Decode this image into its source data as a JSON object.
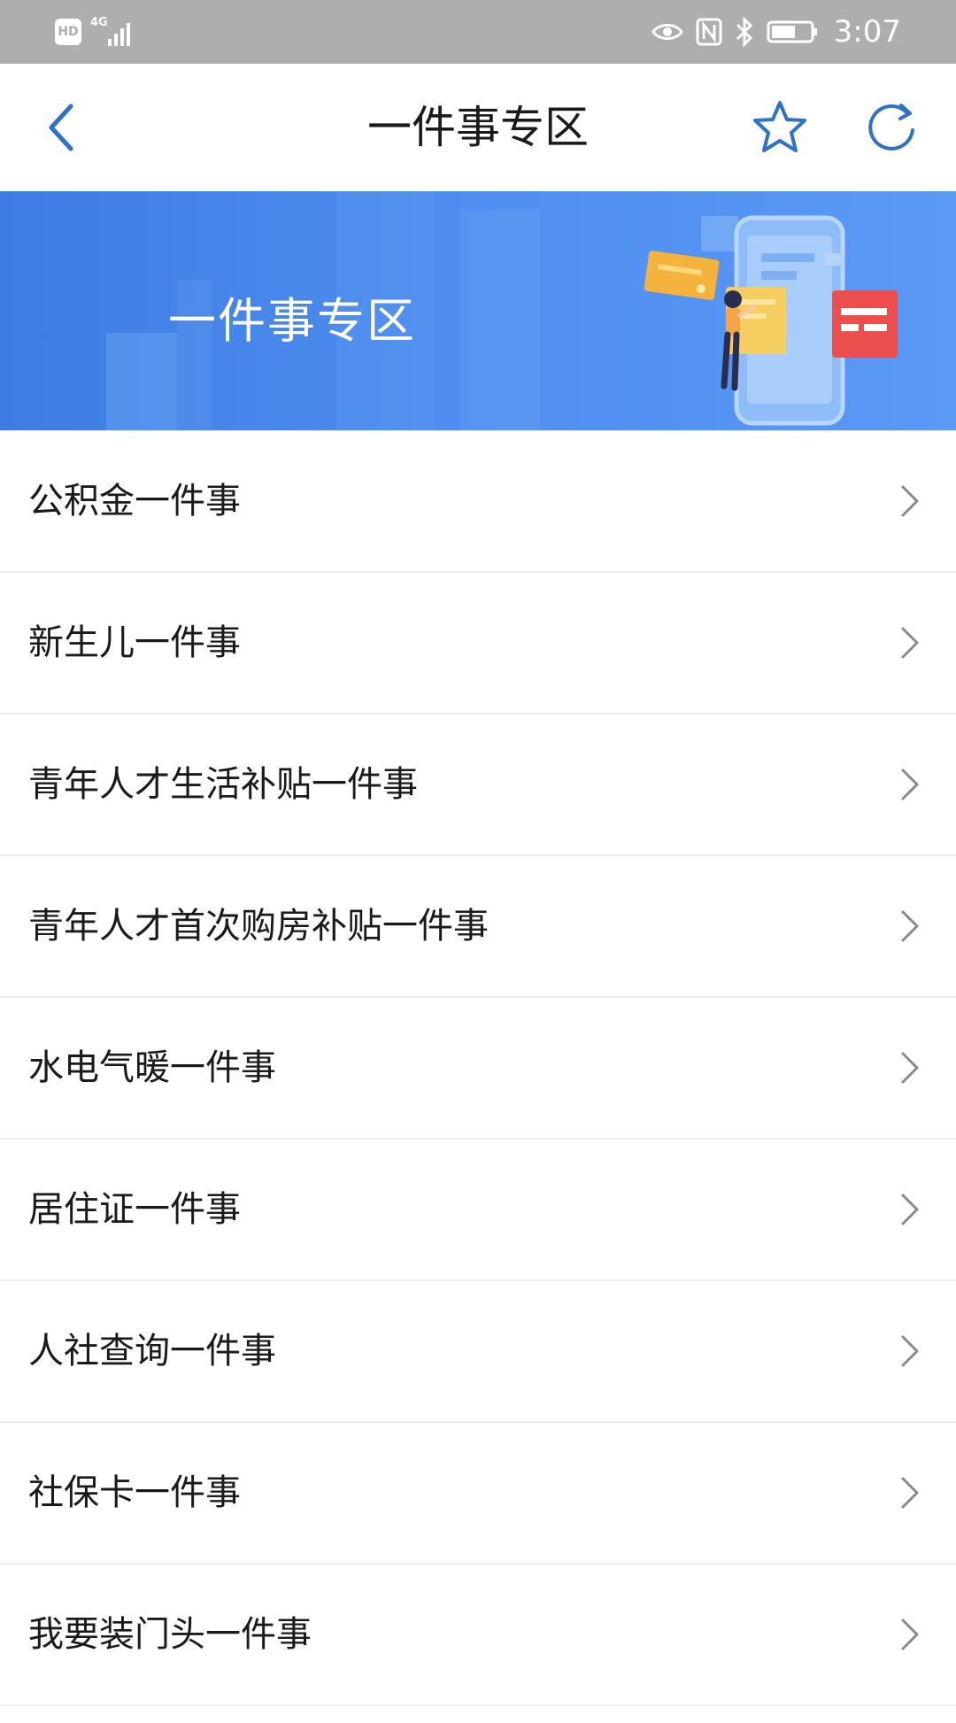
{
  "status_bar": {
    "hd": "HD",
    "network": "4G",
    "time": "3:07",
    "icons": [
      "eye-icon",
      "nfc-icon",
      "bluetooth-icon",
      "battery-icon"
    ]
  },
  "nav": {
    "title": "一件事专区",
    "icons": [
      "back-arrow-icon",
      "star-icon",
      "refresh-icon"
    ],
    "accent_color": "#2d72c8"
  },
  "banner": {
    "title": "一件事专区",
    "background_color": "#4f8ef0"
  },
  "list": {
    "items": [
      {
        "label": "公积金一件事"
      },
      {
        "label": "新生儿一件事"
      },
      {
        "label": "青年人才生活补贴一件事"
      },
      {
        "label": "青年人才首次购房补贴一件事"
      },
      {
        "label": "水电气暖一件事"
      },
      {
        "label": "居住证一件事"
      },
      {
        "label": "人社查询一件事"
      },
      {
        "label": "社保卡一件事"
      },
      {
        "label": "我要装门头一件事"
      }
    ]
  }
}
